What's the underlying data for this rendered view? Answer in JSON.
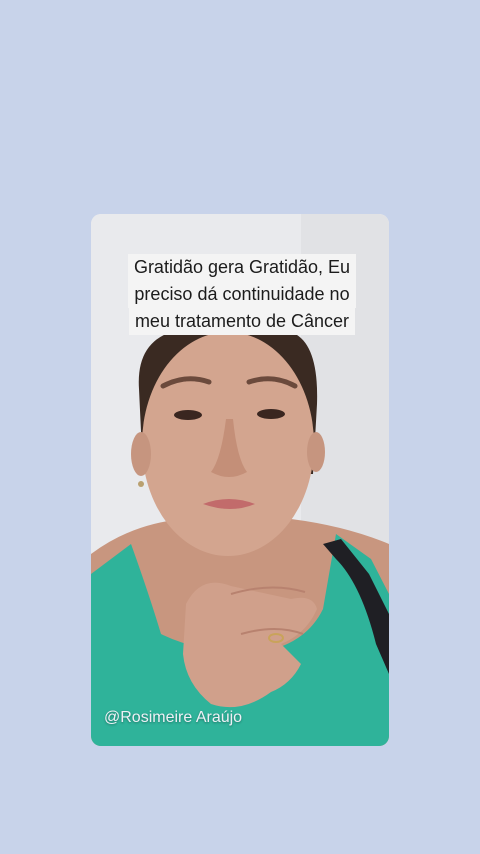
{
  "caption": {
    "lines": [
      "Gratidão gera Gratidão, Eu",
      "preciso dá continuidade no",
      "meu tratamento de Câncer"
    ]
  },
  "watermark": {
    "handle": "@Rosimeire Araújo"
  },
  "colors": {
    "page_background": "#c8d3ea",
    "caption_background": "#f4f4f4",
    "tank_top": "#2fb39a"
  }
}
